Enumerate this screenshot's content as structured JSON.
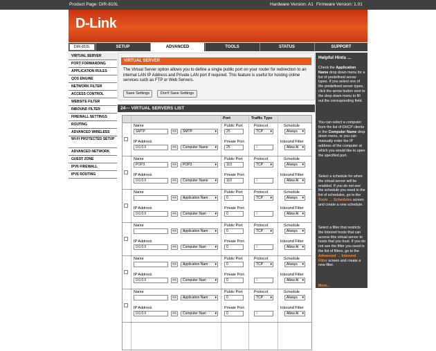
{
  "topbar": {
    "product": "Product Page: DIR-810L",
    "hardware": "Hardware Version: A1",
    "firmware": "Firmware Version: 1.01"
  },
  "brand": {
    "logo": "D-Link",
    "accent": "#e35a1e",
    "dark": "#404040"
  },
  "nav": {
    "model": "DIR-810L",
    "tabs": [
      "SETUP",
      "ADVANCED",
      "TOOLS",
      "STATUS",
      "SUPPORT"
    ],
    "active": "ADVANCED"
  },
  "sidebar": {
    "items": [
      "VIRTUAL SERVER",
      "PORT FORWARDING",
      "APPLICATION RULES",
      "QOS ENGINE",
      "NETWORK FILTER",
      "ACCESS CONTROL",
      "WEBSITE FILTER",
      "INBOUND FILTER",
      "FIREWALL SETTINGS",
      "ROUTING",
      "ADVANCED WIRELESS",
      "WI-FI PROTECTED SETUP",
      "ADVANCED NETWORK",
      "GUEST ZONE",
      "IPV6 FIREWALL",
      "IPV6 ROUTING"
    ]
  },
  "vs": {
    "title": "VIRTUAL SERVER",
    "desc": "The Virtual Server option allows you to define a single public port on your router for redirection to an internal LAN IP Address and Private LAN port if required. This feature is useful for hosting online services such as FTP or Web Servers.",
    "save": "Save Settings",
    "dontsave": "Don't Save Settings"
  },
  "list": {
    "title": "24--- VIRTUAL SERVERS LIST",
    "hdr_port": "Port",
    "hdr_traffic": "Traffic Type",
    "lbl_name": "Name",
    "lbl_ip": "IP Address",
    "lbl_public": "Public Port",
    "lbl_private": "Private Port",
    "lbl_protocol": "Protocol",
    "lbl_schedule": "Schedule",
    "lbl_inbound": "Inbound Filter",
    "arrow": "<<",
    "rows": [
      {
        "name": "SMTP",
        "app": "SMTP",
        "ip": "0.0.0.0",
        "computer": "Computer Name",
        "public": "25",
        "private": "25",
        "protocol": "TCP",
        "proto_num": "6",
        "schedule": "Always",
        "inbound": "Allow Al"
      },
      {
        "name": "POP3",
        "app": "POP3",
        "ip": "0.0.0.0",
        "computer": "Computer Name",
        "public": "110",
        "private": "110",
        "protocol": "TCP",
        "proto_num": "6",
        "schedule": "Always",
        "inbound": "Allow Al"
      },
      {
        "name": "",
        "app": "Application Nam",
        "ip": "0.0.0.0",
        "computer": "Computer Nam",
        "public": "0",
        "private": "0",
        "protocol": "TCP",
        "proto_num": "6",
        "schedule": "Always",
        "inbound": "Allow Al"
      },
      {
        "name": "",
        "app": "Application Nam",
        "ip": "0.0.0.0",
        "computer": "Computer Nam",
        "public": "0",
        "private": "0",
        "protocol": "TCP",
        "proto_num": "6",
        "schedule": "Always",
        "inbound": "Allow Al"
      },
      {
        "name": "",
        "app": "Application Nam",
        "ip": "0.0.0.0",
        "computer": "Computer Nam",
        "public": "0",
        "private": "0",
        "protocol": "TCP",
        "proto_num": "6",
        "schedule": "Always",
        "inbound": "Allow Al"
      },
      {
        "name": "",
        "app": "Application Nam",
        "ip": "0.0.0.0",
        "computer": "Computer Nam",
        "public": "0",
        "private": "0",
        "protocol": "TCP",
        "proto_num": "6",
        "schedule": "Always",
        "inbound": "Allow Al"
      }
    ]
  },
  "help": {
    "title": "Helpful Hints ...",
    "p1a": "Check the ",
    "p1b": "Application Name",
    "p1c": " drop down menu for a list of predefined server types. If you select one of the predefined server types, click the arrow button next to the drop down menu to fill out the corresponding field.",
    "p2a": "You can select a computer from the list of DHCP clients in the ",
    "p2b": "Computer Name",
    "p2c": " drop down menu, or you can manually enter the IP address of the computer at which you would like to open the specified port.",
    "p3a": "Select a schedule for when the virtual server will be enabled. If you do not see the schedule you need in the list of schedules, go to the ",
    "p3b": "Tools → Schedules",
    "p3c": " screen and create a new schedule.",
    "p4a": "Select a filter that restricts the Internet hosts that can access this virtual server to hosts that you trust. If you do not see the filter you need in the list of filters, go to the ",
    "p4b": "Advanced → Inbound Filter",
    "p4c": " screen and create a new filter.",
    "more": "More..."
  }
}
